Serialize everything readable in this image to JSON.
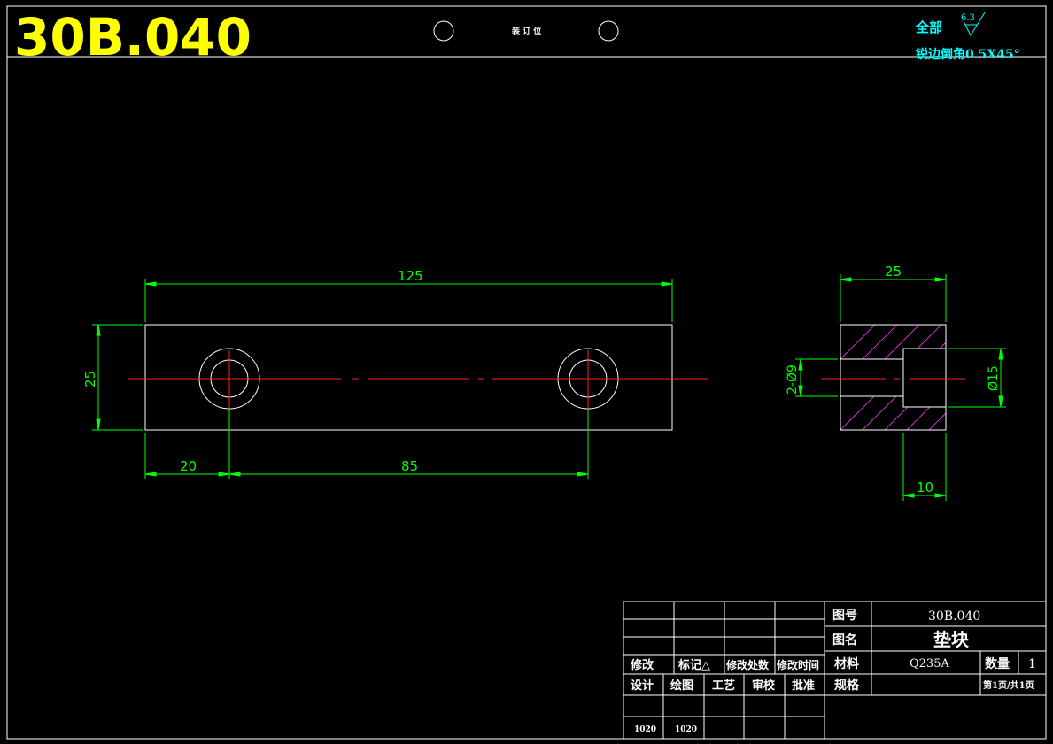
{
  "header": {
    "drawing_code": "30B.040",
    "binding_label": "装 订 位",
    "surface_prefix": "全部",
    "roughness_value": "6.3",
    "chamfer_note": "锐边倒角0.5X45°"
  },
  "front_view": {
    "dim_length": "125",
    "dim_height": "25",
    "dim_hole_offset": "20",
    "dim_hole_spacing": "85"
  },
  "side_view": {
    "dim_width": "25",
    "dim_hole": "2-Ø9",
    "dim_counterbore": "Ø15",
    "dim_depth": "10"
  },
  "title_block": {
    "label_drawing_no": "图号",
    "drawing_no": "30B.040",
    "label_name": "图名",
    "part_name": "垫块",
    "label_material": "材料",
    "material": "Q235A",
    "label_qty": "数量",
    "qty": "1",
    "label_spec": "规格",
    "sheet": "第1页/共1页",
    "rev_headers": [
      "修改",
      "标记△",
      "修改处数",
      "修改时间"
    ],
    "sign_headers": [
      "设计",
      "绘图",
      "工艺",
      "审校",
      "批准"
    ],
    "sign_values": [
      "1020",
      "1020"
    ]
  }
}
